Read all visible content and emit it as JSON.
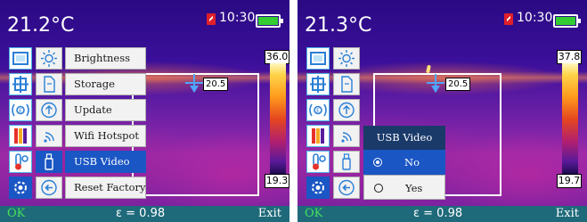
{
  "screens": [
    {
      "temperature": "21.2°C",
      "time": "10:30",
      "scale_max": "36.0",
      "scale_min": "19.3",
      "spot_temp": "20.5",
      "bottom": {
        "ok": "OK",
        "emissivity": "ε = 0.98",
        "exit": "Exit"
      },
      "menu": [
        {
          "label": "Brightness",
          "icon": "sun-icon",
          "selected": false
        },
        {
          "label": "Storage",
          "icon": "document-icon",
          "selected": false
        },
        {
          "label": "Update",
          "icon": "up-arrow-circle-icon",
          "selected": false
        },
        {
          "label": "Wifi Hotspot",
          "icon": "wifi-icon",
          "selected": false
        },
        {
          "label": "USB Video",
          "icon": "usb-drive-icon",
          "selected": true
        },
        {
          "label": "Reset Factory",
          "icon": "reset-icon",
          "selected": false
        }
      ]
    },
    {
      "temperature": "21.3°C",
      "time": "10:30",
      "scale_max": "37.8",
      "scale_min": "19.7",
      "spot_temp": "20.5",
      "bottom": {
        "ok": "OK",
        "emissivity": "ε = 0.98",
        "exit": "Exit"
      },
      "submenu": {
        "title": "USB Video",
        "options": [
          {
            "label": "No",
            "selected": true
          },
          {
            "label": "Yes",
            "selected": false
          }
        ]
      }
    }
  ],
  "tools": [
    "frame-icon",
    "center-point-icon",
    "emissivity-icon",
    "palette-icon",
    "thermometer-settings-icon",
    "settings-gear-icon"
  ],
  "colors": {
    "accent_blue": "#1a56c4",
    "bottom_bar": "#1e6a7a",
    "ok_green": "#45e05b",
    "battery_green": "#33cc33",
    "warning_red": "#e0202a"
  }
}
